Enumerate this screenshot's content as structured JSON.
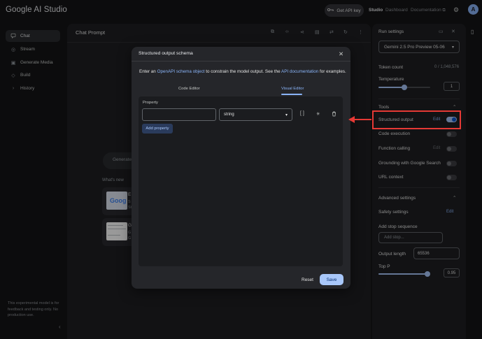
{
  "app": {
    "title": "Google AI Studio"
  },
  "topbar": {
    "api_key_label": "Get API key",
    "nav": [
      "Studio",
      "Dashboard",
      "Documentation"
    ],
    "avatar_letter": "A"
  },
  "sidebar": {
    "items": [
      {
        "label": "Chat",
        "icon": "chat-icon"
      },
      {
        "label": "Stream",
        "icon": "stream-icon"
      },
      {
        "label": "Generate Media",
        "icon": "media-icon"
      },
      {
        "label": "Build",
        "icon": "build-icon"
      },
      {
        "label": "History",
        "icon": "history-icon"
      }
    ],
    "note": "This experimental model is for feedback and testing only. No production use."
  },
  "main": {
    "title": "Chat Prompt",
    "behind": {
      "pill_text": "Generate",
      "whats_new": "What's new",
      "card1_letter": "E",
      "card1_lines": [
        "S",
        "St"
      ],
      "card1_thumb": "Goog",
      "card2_letter": "G",
      "card2_lines": [
        "G",
        "G"
      ]
    }
  },
  "dialog": {
    "title": "Structured output schema",
    "desc_prefix": "Enter an ",
    "desc_link1": "OpenAPI schema object",
    "desc_mid": " to constrain the model output. See the ",
    "desc_link2": "API documentation",
    "desc_suffix": " for examples.",
    "tabs": [
      "Code Editor",
      "Visual Editor"
    ],
    "active_tab": "Visual Editor",
    "property_label": "Property",
    "property_value": "",
    "type_value": "string",
    "add_property_label": "Add property",
    "reset_label": "Reset",
    "save_label": "Save"
  },
  "run_settings": {
    "title": "Run settings",
    "model": "Gemini 2.5 Pro Preview 05-06",
    "token_count_label": "Token count",
    "token_count_value": "0 / 1,048,576",
    "temperature_label": "Temperature",
    "temperature_value": "1",
    "temperature": 1,
    "temperature_max": 2,
    "tools_label": "Tools",
    "tools": [
      {
        "label": "Structured output",
        "edit": "Edit",
        "edit_enabled": true,
        "on": true
      },
      {
        "label": "Code execution",
        "edit": "",
        "edit_enabled": false,
        "on": false
      },
      {
        "label": "Function calling",
        "edit": "Edit",
        "edit_enabled": false,
        "on": false
      },
      {
        "label": "Grounding with Google Search",
        "edit": "",
        "edit_enabled": false,
        "on": false
      },
      {
        "label": "URL context",
        "edit": "",
        "edit_enabled": false,
        "on": false
      }
    ],
    "advanced_label": "Advanced settings",
    "safety_label": "Safety settings",
    "safety_edit": "Edit",
    "stop_label": "Add stop sequence",
    "stop_placeholder": "Add stop...",
    "output_length_label": "Output length",
    "output_length_value": "65536",
    "top_p_label": "Top P",
    "top_p_value": "0.95",
    "top_p": 0.95
  },
  "colors": {
    "accent": "#a8c7fa",
    "link": "#8ab4f8",
    "annotation": "#e53935"
  }
}
